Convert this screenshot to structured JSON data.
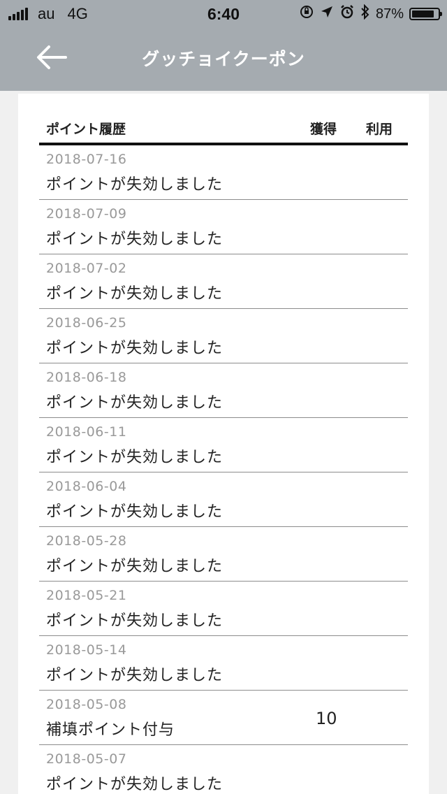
{
  "status_bar": {
    "carrier": "au",
    "network": "4G",
    "time": "6:40",
    "battery_percent": "87%",
    "battery_level": 0.87
  },
  "nav": {
    "title": "グッチョイクーポン"
  },
  "table": {
    "header_title": "ポイント履歴",
    "header_earn": "獲得",
    "header_use": "利用",
    "rows": [
      {
        "date": "2018-07-16",
        "desc": "ポイントが失効しました",
        "earn": "",
        "use": ""
      },
      {
        "date": "2018-07-09",
        "desc": "ポイントが失効しました",
        "earn": "",
        "use": ""
      },
      {
        "date": "2018-07-02",
        "desc": "ポイントが失効しました",
        "earn": "",
        "use": ""
      },
      {
        "date": "2018-06-25",
        "desc": "ポイントが失効しました",
        "earn": "",
        "use": ""
      },
      {
        "date": "2018-06-18",
        "desc": "ポイントが失効しました",
        "earn": "",
        "use": ""
      },
      {
        "date": "2018-06-11",
        "desc": "ポイントが失効しました",
        "earn": "",
        "use": ""
      },
      {
        "date": "2018-06-04",
        "desc": "ポイントが失効しました",
        "earn": "",
        "use": ""
      },
      {
        "date": "2018-05-28",
        "desc": "ポイントが失効しました",
        "earn": "",
        "use": ""
      },
      {
        "date": "2018-05-21",
        "desc": "ポイントが失効しました",
        "earn": "",
        "use": ""
      },
      {
        "date": "2018-05-14",
        "desc": "ポイントが失効しました",
        "earn": "",
        "use": ""
      },
      {
        "date": "2018-05-08",
        "desc": "補填ポイント付与",
        "earn": "10",
        "use": ""
      },
      {
        "date": "2018-05-07",
        "desc": "ポイントが失効しました",
        "earn": "",
        "use": ""
      }
    ]
  },
  "colors": {
    "header_bg": "#a5abb0",
    "page_bg": "#f0f0f0",
    "date_text": "#999999"
  },
  "icons": {
    "back": "arrow-left-icon",
    "orientation_lock": "orientation-lock-icon",
    "location": "location-arrow-icon",
    "alarm": "alarm-clock-icon",
    "bluetooth": "bluetooth-icon"
  }
}
